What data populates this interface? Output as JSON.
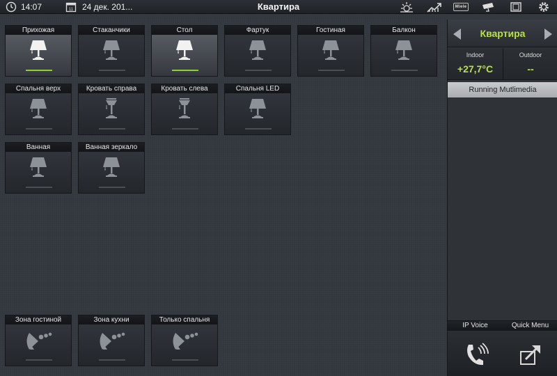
{
  "header": {
    "time": "14:07",
    "date": "24 дек. 201...",
    "title": "Квартира",
    "brand": "Miele"
  },
  "lights": [
    {
      "label": "Прихожая",
      "on": true,
      "icon": "table-lamp-icon"
    },
    {
      "label": "Стаканчики",
      "on": false,
      "icon": "table-lamp-icon"
    },
    {
      "label": "Стол",
      "on": true,
      "icon": "table-lamp-icon"
    },
    {
      "label": "Фартук",
      "on": false,
      "icon": "table-lamp-icon"
    },
    {
      "label": "Гостиная",
      "on": false,
      "icon": "table-lamp-icon"
    },
    {
      "label": "Балкон",
      "on": false,
      "icon": "table-lamp-icon"
    },
    {
      "label": "Спальня верх",
      "on": false,
      "icon": "table-lamp-icon"
    },
    {
      "label": "Кровать справа",
      "on": false,
      "icon": "ceiling-lamp-icon"
    },
    {
      "label": "Кровать слева",
      "on": false,
      "icon": "ceiling-lamp-icon"
    },
    {
      "label": "Спальня LED",
      "on": false,
      "icon": "table-lamp-icon"
    },
    {
      "label": "Ванная",
      "on": false,
      "icon": "table-lamp-icon"
    },
    {
      "label": "Ванная зеркало",
      "on": false,
      "icon": "table-lamp-icon"
    }
  ],
  "zones": [
    {
      "label": "Зона гостиной",
      "icon": "audio-zone-icon"
    },
    {
      "label": "Зона кухни",
      "icon": "audio-zone-icon"
    },
    {
      "label": "Только спальня",
      "icon": "audio-zone-icon"
    }
  ],
  "panel": {
    "title": "Квартира",
    "indoor_label": "Indoor",
    "indoor_value": "+27,7°C",
    "outdoor_label": "Outdoor",
    "outdoor_value": "--",
    "running": "Running Mutlimedia",
    "ip_voice": "IP Voice",
    "quick_menu": "Quick Menu"
  },
  "colors": {
    "accent": "#b8e04a",
    "on_bar": "#8fd12f",
    "background": "#33383f"
  }
}
